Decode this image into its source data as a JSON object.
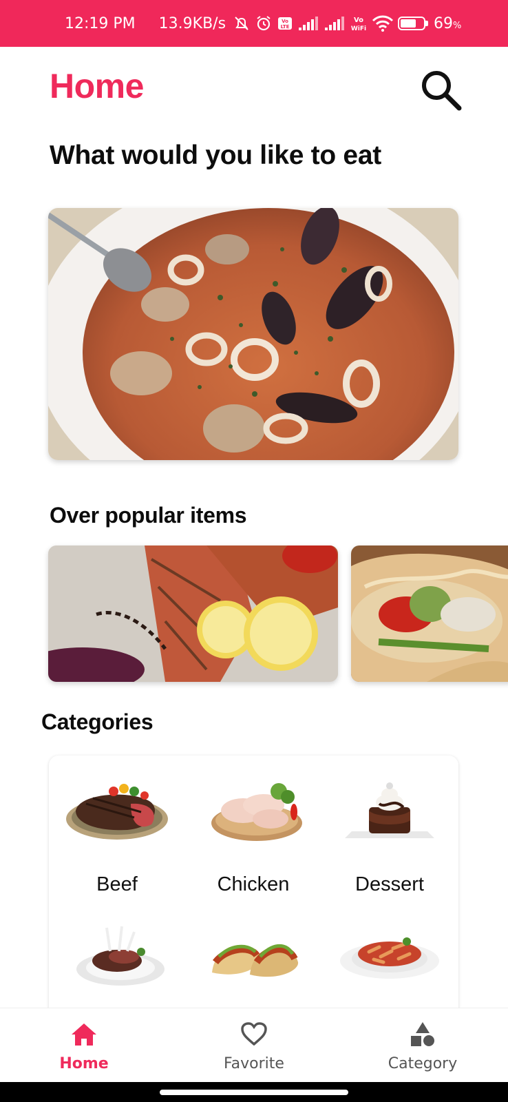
{
  "status_bar": {
    "time": "12:19 PM",
    "speed": "13.9KB/s",
    "volte": "Vo LTE",
    "vowifi": "Vo WiFi",
    "battery": "69",
    "battery_unit": "%",
    "battery_level": 0.69,
    "color": "#f0285a"
  },
  "header": {
    "title": "Home",
    "search_icon": "search-icon",
    "accent": "#ef2a5b"
  },
  "main": {
    "question": "What would you like to eat",
    "hero_image": "seafood-soup-photo"
  },
  "popular": {
    "heading": "Over popular items",
    "items": [
      {
        "image": "grilled-salmon-photo"
      },
      {
        "image": "fish-taco-photo"
      }
    ]
  },
  "categories": {
    "heading": "Categories",
    "items": [
      {
        "label": "Beef",
        "image": "beef-steak"
      },
      {
        "label": "Chicken",
        "image": "raw-chicken"
      },
      {
        "label": "Dessert",
        "image": "chocolate-cake"
      },
      {
        "label": "",
        "image": "lamb-chops"
      },
      {
        "label": "",
        "image": "tacos"
      },
      {
        "label": "",
        "image": "pasta"
      }
    ]
  },
  "bottom_nav": {
    "items": [
      {
        "label": "Home",
        "icon": "home-icon",
        "active": true
      },
      {
        "label": "Favorite",
        "icon": "heart-icon",
        "active": false
      },
      {
        "label": "Category",
        "icon": "shapes-icon",
        "active": false
      }
    ]
  }
}
